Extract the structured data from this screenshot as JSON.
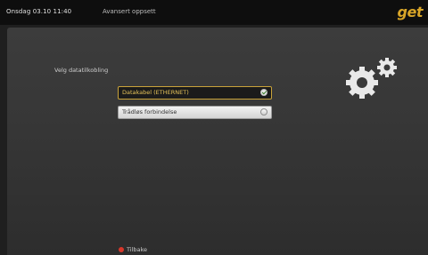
{
  "header": {
    "datetime": "Onsdag 03.10 11:40",
    "breadcrumb": "Avansert oppsett",
    "logo_text": "get"
  },
  "main": {
    "prompt": "Velg datatilkobling",
    "options": [
      {
        "label": "Datakabel (ETHERNET)",
        "selected": true
      },
      {
        "label": "Trådløs forbindelse",
        "selected": false
      }
    ]
  },
  "footer": {
    "back_label": "Tilbake",
    "back_key_color": "#d8382b"
  },
  "icons": {
    "settings": "gears-icon"
  },
  "colors": {
    "accent": "#d8a528",
    "selection_border": "#c9a33a"
  }
}
